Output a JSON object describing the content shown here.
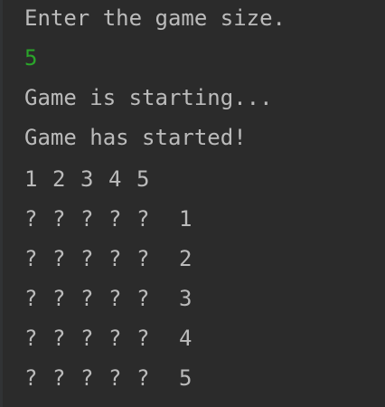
{
  "console": {
    "prompt": "Enter the game size.",
    "input_value": "5",
    "status_starting": "Game is starting...",
    "status_started": "Game has started!",
    "colors": {
      "background": "#2b2b2b",
      "text": "#bbbbbb",
      "user_input": "#2aa52a"
    }
  },
  "board": {
    "column_headers": [
      "1",
      "2",
      "3",
      "4",
      "5"
    ],
    "rows": [
      {
        "cells": [
          "?",
          "?",
          "?",
          "?",
          "?"
        ],
        "label": "1"
      },
      {
        "cells": [
          "?",
          "?",
          "?",
          "?",
          "?"
        ],
        "label": "2"
      },
      {
        "cells": [
          "?",
          "?",
          "?",
          "?",
          "?"
        ],
        "label": "3"
      },
      {
        "cells": [
          "?",
          "?",
          "?",
          "?",
          "?"
        ],
        "label": "4"
      },
      {
        "cells": [
          "?",
          "?",
          "?",
          "?",
          "?"
        ],
        "label": "5"
      }
    ]
  }
}
